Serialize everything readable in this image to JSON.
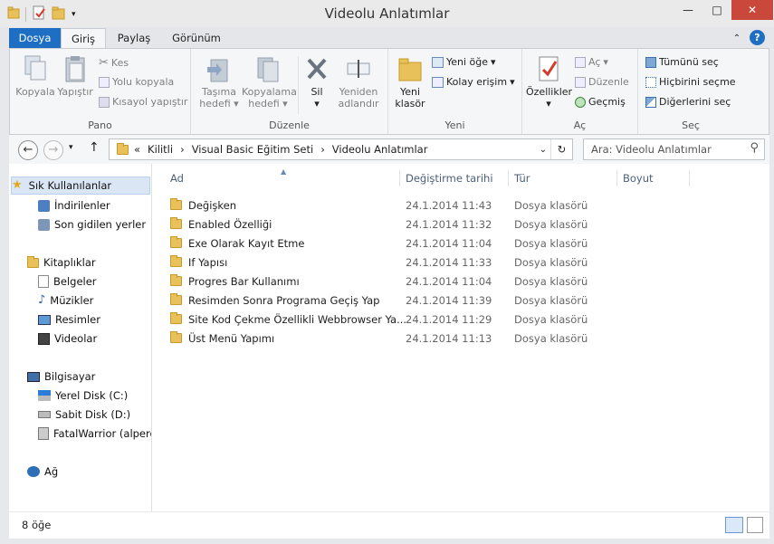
{
  "window": {
    "title": "Videolu Anlatımlar",
    "minimize": "—",
    "maximize": "□",
    "close": "✕"
  },
  "tabs": [
    "Dosya",
    "Giriş",
    "Paylaş",
    "Görünüm"
  ],
  "ribbon": {
    "pano": {
      "label": "Pano",
      "copy": "Kopyala",
      "paste": "Yapıştır",
      "cut": "Kes",
      "copy_path": "Yolu kopyala",
      "paste_shortcut": "Kısayol yapıştır"
    },
    "duzenle": {
      "label": "Düzenle",
      "move_to": "Taşıma hedefi",
      "copy_to": "Kopyalama hedefi",
      "delete": "Sil",
      "rename": "Yeniden adlandır"
    },
    "yeni": {
      "label": "Yeni",
      "new_folder": "Yeni klasör",
      "new_item": "Yeni öğe",
      "easy_access": "Kolay erişim"
    },
    "ac": {
      "label": "Aç",
      "properties": "Özellikler",
      "open": "Aç",
      "edit": "Düzenle",
      "history": "Geçmiş"
    },
    "sec": {
      "label": "Seç",
      "select_all": "Tümünü seç",
      "select_none": "Hiçbirini seçme",
      "invert": "Diğerlerini seç"
    }
  },
  "address": {
    "prefix": "«",
    "crumbs": [
      "Kilitli",
      "Visual Basic Eğitim Seti",
      "Videolu Anlatımlar"
    ],
    "search_placeholder": "Ara: Videolu Anlatımlar"
  },
  "nav": {
    "favorites": "Sık Kullanılanlar",
    "downloads": "İndirilenler",
    "recent": "Son gidilen yerler",
    "libraries": "Kitaplıklar",
    "documents": "Belgeler",
    "music": "Müzikler",
    "pictures": "Resimler",
    "videos": "Videolar",
    "computer": "Bilgisayar",
    "disk_c": "Yerel Disk (C:)",
    "disk_d": "Sabit Disk (D:)",
    "network_drive": "FatalWarrior (alperen",
    "network": "Ağ"
  },
  "columns": {
    "name": "Ad",
    "date": "Değiştirme tarihi",
    "type": "Tür",
    "size": "Boyut"
  },
  "files": [
    {
      "name": "Değişken",
      "date": "24.1.2014 11:43",
      "type": "Dosya klasörü"
    },
    {
      "name": "Enabled Özelliği",
      "date": "24.1.2014 11:32",
      "type": "Dosya klasörü"
    },
    {
      "name": "Exe Olarak Kayıt Etme",
      "date": "24.1.2014 11:04",
      "type": "Dosya klasörü"
    },
    {
      "name": "If Yapısı",
      "date": "24.1.2014 11:33",
      "type": "Dosya klasörü"
    },
    {
      "name": "Progres Bar Kullanımı",
      "date": "24.1.2014 11:04",
      "type": "Dosya klasörü"
    },
    {
      "name": "Resimden Sonra Programa Geçiş Yap",
      "date": "24.1.2014 11:39",
      "type": "Dosya klasörü"
    },
    {
      "name": "Site Kod Çekme Özellikli Webbrowser Ya...",
      "date": "24.1.2014 11:29",
      "type": "Dosya klasörü"
    },
    {
      "name": "Üst Menü Yapımı",
      "date": "24.1.2014 11:13",
      "type": "Dosya klasörü"
    }
  ],
  "status": {
    "count": "8 öğe"
  },
  "colors": {
    "file_tab": "#1e6fc3",
    "close_button": "#c9483b",
    "header_text": "#4c607a"
  }
}
